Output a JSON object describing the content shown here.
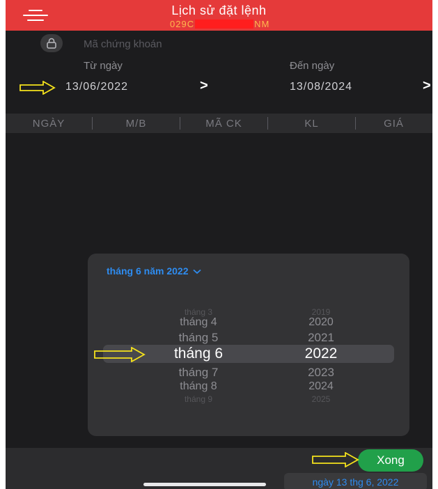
{
  "header": {
    "title": "Lịch sử đặt lệnh",
    "account_prefix": "029C",
    "account_suffix": "NM"
  },
  "search": {
    "placeholder": "Mã chứng khoán",
    "value": ""
  },
  "dates": {
    "from_label": "Từ ngày",
    "from_value": "13/06/2022",
    "to_label": "Đến ngày",
    "to_value": "13/08/2024",
    "chevron": ">"
  },
  "table": {
    "columns": [
      "NGÀY",
      "M/B",
      "MÃ CK",
      "KL",
      "GIÁ"
    ]
  },
  "picker": {
    "month_toggle": "tháng 6 năm 2022",
    "months": [
      "tháng 3",
      "tháng 4",
      "tháng 5",
      "tháng 6",
      "tháng 7",
      "tháng 8",
      "tháng 9"
    ],
    "years": [
      "2019",
      "2020",
      "2021",
      "2022",
      "2023",
      "2024",
      "2025"
    ],
    "selected_month": "tháng 6",
    "selected_year": "2022"
  },
  "footer": {
    "done_label": "Xong",
    "selected_date": "ngày 13 thg 6, 2022"
  },
  "colors": {
    "header_red": "#e53a3a",
    "accent_blue": "#2e8cf0",
    "done_green": "#21a04a",
    "annotation_yellow": "#f5e21c"
  },
  "icons": {
    "menu": "menu-icon",
    "lock": "lock-icon",
    "chevron_down": "chevron-down-icon",
    "annotation_arrow": "arrow-right-icon"
  }
}
